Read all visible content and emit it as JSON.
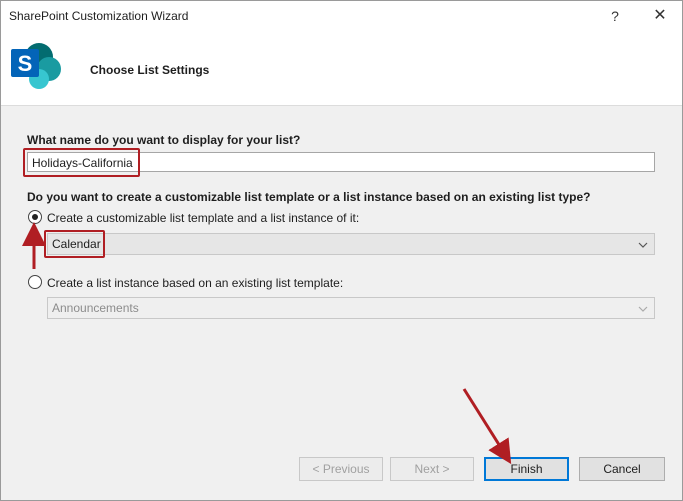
{
  "window": {
    "title": "SharePoint Customization Wizard",
    "help_label": "?",
    "close_label": "✕"
  },
  "header": {
    "title": "Choose List Settings",
    "logo_letter": "S",
    "logo_color": "#0364b8"
  },
  "form": {
    "name_question": "What name do you want to display for your list?",
    "name_value": "Holidays-California",
    "type_question": "Do you want to create a customizable list template or a list instance based on an existing list type?",
    "option_template_label": "Create a customizable list template and a list instance of it:",
    "option_template_selected": "Calendar",
    "option_instance_label": "Create a list instance based on an existing list template:",
    "option_instance_selected": "Announcements"
  },
  "buttons": {
    "previous": "< Previous",
    "next": "Next >",
    "finish": "Finish",
    "cancel": "Cancel"
  },
  "colors": {
    "annotation": "#b01e23",
    "focus": "#0078d7"
  }
}
